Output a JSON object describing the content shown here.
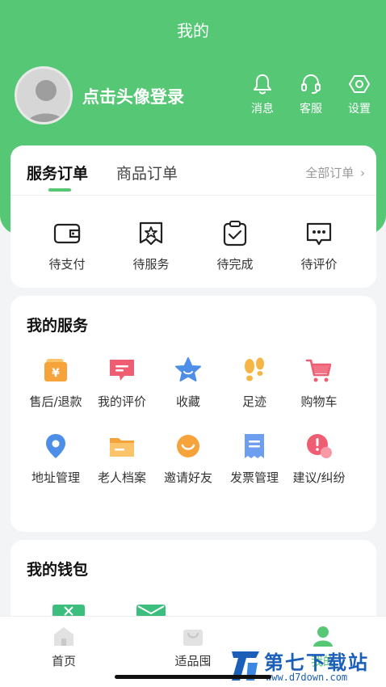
{
  "header": {
    "title": "我的",
    "login_text": "点击头像登录"
  },
  "top_actions": [
    {
      "label": "消息",
      "icon": "bell-icon"
    },
    {
      "label": "客服",
      "icon": "headset-icon"
    },
    {
      "label": "设置",
      "icon": "settings-hexagon-icon"
    }
  ],
  "orders": {
    "tabs": [
      "服务订单",
      "商品订单"
    ],
    "all_label": "全部订单",
    "items": [
      {
        "label": "待支付",
        "icon": "wallet-icon"
      },
      {
        "label": "待服务",
        "icon": "star-bookmark-icon"
      },
      {
        "label": "待完成",
        "icon": "clipboard-check-icon"
      },
      {
        "label": "待评价",
        "icon": "message-dots-icon"
      }
    ]
  },
  "services": {
    "title": "我的服务",
    "items": [
      {
        "label": "售后/退款",
        "icon": "refund-icon"
      },
      {
        "label": "我的评价",
        "icon": "review-icon"
      },
      {
        "label": "收藏",
        "icon": "favorite-star-icon"
      },
      {
        "label": "足迹",
        "icon": "footprint-icon"
      },
      {
        "label": "购物车",
        "icon": "cart-icon"
      },
      {
        "label": "地址管理",
        "icon": "location-pin-icon"
      },
      {
        "label": "老人档案",
        "icon": "folder-icon"
      },
      {
        "label": "邀请好友",
        "icon": "smile-invite-icon"
      },
      {
        "label": "发票管理",
        "icon": "invoice-icon"
      },
      {
        "label": "建议/纠纷",
        "icon": "alert-bubble-icon"
      }
    ]
  },
  "wallet": {
    "title": "我的钱包"
  },
  "bottom_nav": [
    {
      "label": "首页",
      "icon": "home-icon"
    },
    {
      "label": "适品囤",
      "icon": "shop-bag-icon"
    },
    {
      "label": "我的",
      "icon": "user-icon"
    }
  ],
  "watermark": {
    "text": "第七下载站",
    "url": "www.d7down.com"
  },
  "colors": {
    "brand": "#56c774",
    "background": "#f3f4f6"
  }
}
